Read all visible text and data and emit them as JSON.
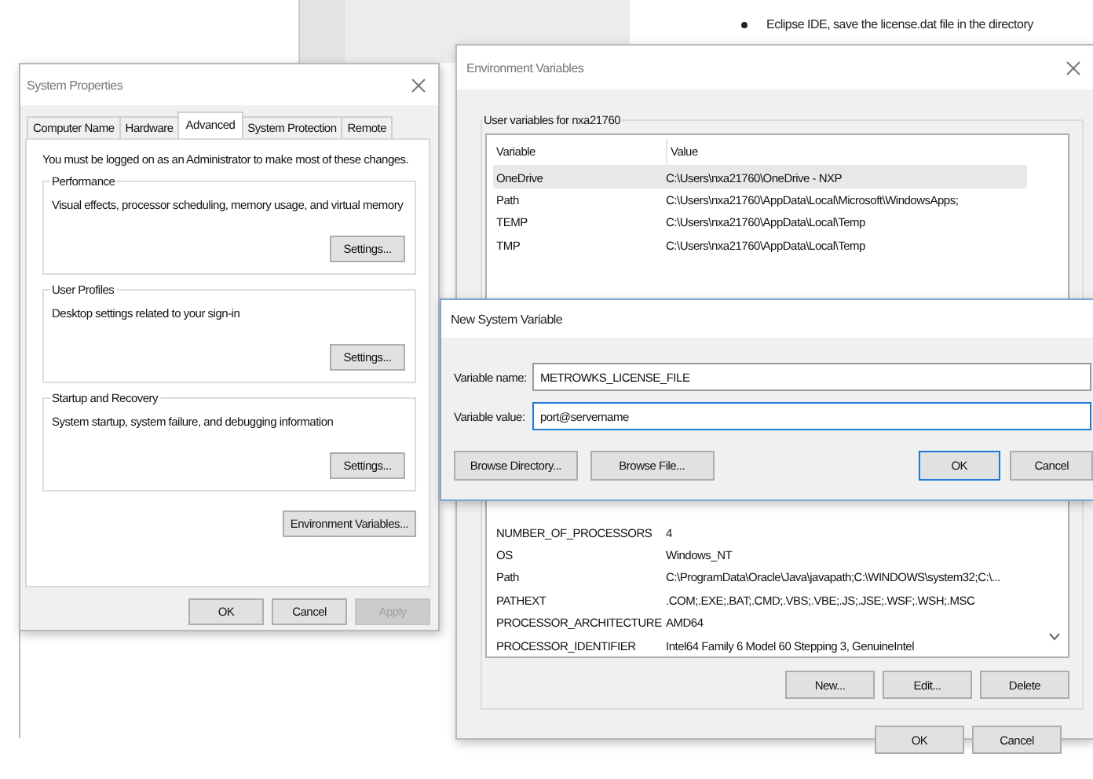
{
  "background_document": {
    "bullets": [
      "Eclipse IDE, save the license.dat file in the directory"
    ]
  },
  "system_properties": {
    "title": "System Properties",
    "tabs": [
      {
        "label": "Computer Name",
        "selected": false
      },
      {
        "label": "Hardware",
        "selected": false
      },
      {
        "label": "Advanced",
        "selected": true
      },
      {
        "label": "System Protection",
        "selected": false
      },
      {
        "label": "Remote",
        "selected": false
      }
    ],
    "notice": "You must be logged on as an Administrator to make most of these changes.",
    "groups": [
      {
        "title": "Performance",
        "description": "Visual effects, processor scheduling, memory usage, and virtual memory",
        "button": "Settings..."
      },
      {
        "title": "User Profiles",
        "description": "Desktop settings related to your sign-in",
        "button": "Settings..."
      },
      {
        "title": "Startup and Recovery",
        "description": "System startup, system failure, and debugging information",
        "button": "Settings..."
      }
    ],
    "env_button": "Environment Variables...",
    "buttons": [
      {
        "label": "OK",
        "disabled": false
      },
      {
        "label": "Cancel",
        "disabled": false
      },
      {
        "label": "Apply",
        "disabled": true
      }
    ]
  },
  "environment_variables": {
    "title": "Environment Variables",
    "user_group_title": "User variables for nxa21760",
    "columns": [
      "Variable",
      "Value"
    ],
    "user_rows": [
      {
        "variable": "OneDrive",
        "value": "C:\\Users\\nxa21760\\OneDrive - NXP",
        "selected": true
      },
      {
        "variable": "Path",
        "value": "C:\\Users\\nxa21760\\AppData\\Local\\Microsoft\\WindowsApps;",
        "selected": false
      },
      {
        "variable": "TEMP",
        "value": "C:\\Users\\nxa21760\\AppData\\Local\\Temp",
        "selected": false
      },
      {
        "variable": "TMP",
        "value": "C:\\Users\\nxa21760\\AppData\\Local\\Temp",
        "selected": false
      }
    ],
    "system_rows": [
      {
        "variable": "NUMBER_OF_PROCESSORS",
        "value": "4",
        "selected": false
      },
      {
        "variable": "OS",
        "value": "Windows_NT",
        "selected": false
      },
      {
        "variable": "Path",
        "value": "C:\\ProgramData\\Oracle\\Java\\javapath;C:\\WINDOWS\\system32;C:\\...",
        "selected": false
      },
      {
        "variable": "PATHEXT",
        "value": ".COM;.EXE;.BAT;.CMD;.VBS;.VBE;.JS;.JSE;.WSF;.WSH;.MSC",
        "selected": false
      },
      {
        "variable": "PROCESSOR_ARCHITECTURE",
        "value": "AMD64",
        "selected": false
      },
      {
        "variable": "PROCESSOR_IDENTIFIER",
        "value": "Intel64 Family 6 Model 60 Stepping 3, GenuineIntel",
        "selected": false
      }
    ],
    "system_buttons": [
      "New...",
      "Edit...",
      "Delete"
    ],
    "buttons": [
      "OK",
      "Cancel"
    ]
  },
  "new_system_variable": {
    "title": "New System Variable",
    "fields": [
      {
        "label": "Variable name:",
        "value": "METROWKS_LICENSE_FILE",
        "focused": false
      },
      {
        "label": "Variable value:",
        "value": "port@servername",
        "focused": true
      }
    ],
    "buttons": [
      {
        "label": "Browse Directory...",
        "default": false
      },
      {
        "label": "Browse File...",
        "default": false
      },
      {
        "label": "OK",
        "default": true
      },
      {
        "label": "Cancel",
        "default": false
      }
    ]
  }
}
